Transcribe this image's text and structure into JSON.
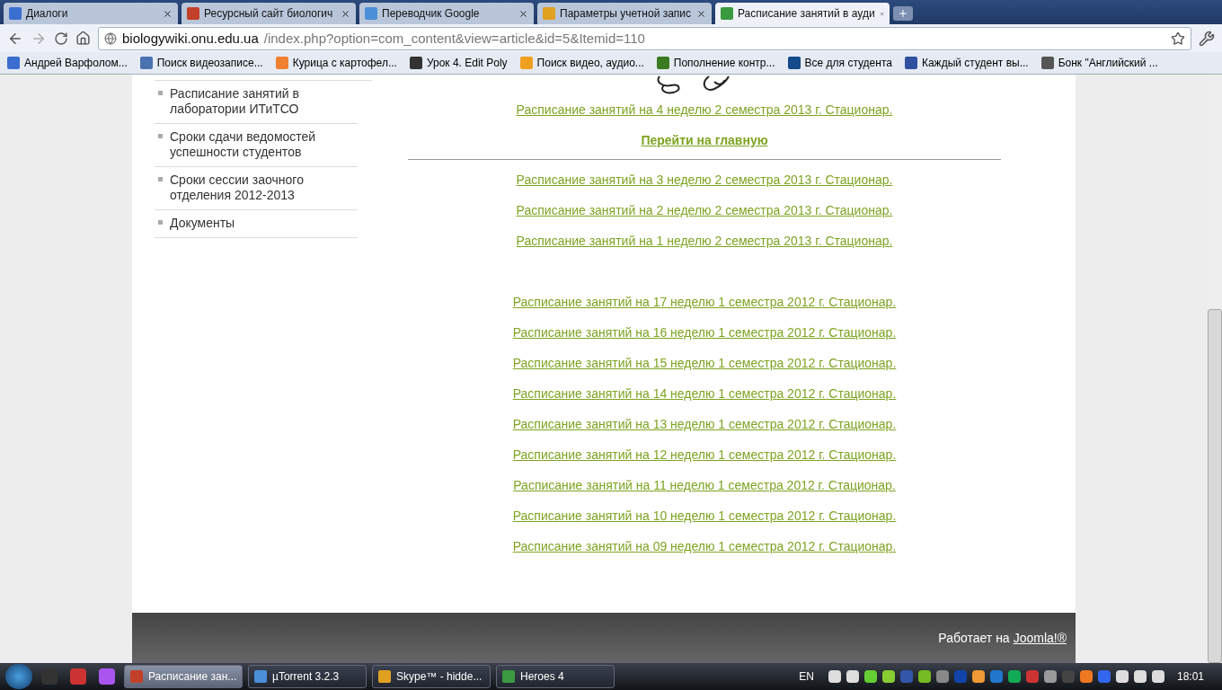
{
  "tabs": [
    {
      "title": "Диалоги",
      "selected": false
    },
    {
      "title": "Ресурсный сайт биологич",
      "selected": false
    },
    {
      "title": "Переводчик Google",
      "selected": false
    },
    {
      "title": "Параметры учетной запис",
      "selected": false
    },
    {
      "title": "Расписание занятий в ауди",
      "selected": true
    }
  ],
  "address": {
    "host": "biologywiki.onu.edu.ua",
    "path": "/index.php?option=com_content&view=article&id=5&Itemid=110"
  },
  "bookmarks": [
    "Андрей Варфолом...",
    "Поиск видеозаписе...",
    "Курица с картофел...",
    "Урок 4. Edit Poly",
    "Поиск видео, аудио...",
    "Пополнение контр...",
    "Все для студента",
    "Каждый студент вы...",
    "Бонк \"Английский ..."
  ],
  "sidebar": {
    "items": [
      "Расписание занятий в лаборатории ИТиТСО",
      "Сроки сдачи ведомостей успешности студентов",
      "Сроки сессии заочного отделения 2012-2013",
      "Документы"
    ]
  },
  "content": {
    "current_link": "Расписание занятий на 4 неделю 2 семестра 2013 г. Стационар.",
    "home_link": "Перейти на главную",
    "link_groups": [
      [
        "Расписание занятий на 3 неделю 2 семестра 2013 г. Стационар.",
        "Расписание занятий на 2 неделю 2 семестра 2013 г. Стационар.",
        "Расписание занятий на 1 неделю 2 семестра 2013 г. Стационар."
      ],
      [
        "Расписание занятий на 17 неделю 1 семестра 2012 г. Стационар.",
        "Расписание занятий на 16 неделю 1 семестра 2012 г. Стационар.",
        "Расписание занятий на 15 неделю 1 семестра 2012 г. Стационар.",
        "Расписание занятий на 14 неделю 1 семестра 2012 г. Стационар.",
        "Расписание занятий на 13 неделю 1 семестра 2012 г. Стационар.",
        "Расписание занятий на 12 неделю 1 семестра 2012 г. Стационар.",
        "Расписание занятий на 11 неделю 1 семестра 2012 г. Стационар.",
        "Расписание занятий на 10 неделю 1 семестра 2012 г. Стационар.",
        "Расписание занятий на 09 неделю 1 семестра 2012 г. Стационар."
      ]
    ]
  },
  "footer": {
    "text": "Работает на",
    "link": "Joomla!®"
  },
  "taskbar": {
    "tasks": [
      {
        "label": "Расписание зан...",
        "selected": true
      },
      {
        "label": "µTorrent 3.2.3",
        "selected": false
      },
      {
        "label": "Skype™ - hidde...",
        "selected": false
      },
      {
        "label": "Heroes 4",
        "selected": false
      }
    ],
    "language": "EN",
    "clock": "18:01"
  }
}
